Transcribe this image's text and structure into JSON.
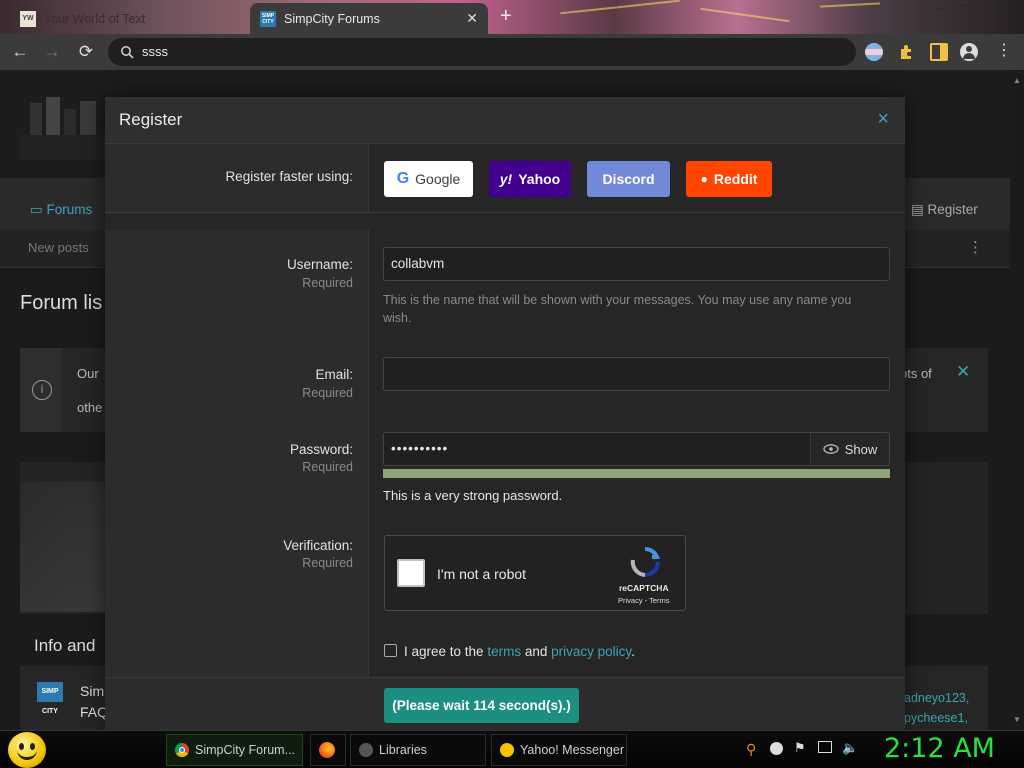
{
  "browser": {
    "tabs": [
      {
        "title": "Your World of Text",
        "favicon": "yw-favicon",
        "active": false
      },
      {
        "title": "SimpCity Forums",
        "favicon": "simpcity-favicon",
        "active": true
      }
    ],
    "favicon_text": {
      "yw": "YW",
      "simpcity": "SIMP CITY"
    },
    "new_tab_label": "+",
    "window_controls": [
      "–",
      "□",
      "✕"
    ],
    "address": "ssss",
    "toolbar_icons": [
      "profile-flag-icon",
      "extensions-icon",
      "sidepanel-icon",
      "account-icon",
      "menu-icon"
    ]
  },
  "background_page": {
    "nav_forums": "Forums",
    "nav_register": "Register",
    "new_posts": "New posts",
    "forum_list_title": "Forum lis",
    "notice_left_1": "Our",
    "notice_left_2": "othe",
    "notice_right": "ots of",
    "info_heading": "Info and",
    "info_line1": "Sim",
    "info_line2": "FAQ",
    "user1": "adneyo123,",
    "user2": "pycheese1,"
  },
  "modal": {
    "title": "Register",
    "close_label": "×",
    "register_faster_label": "Register faster using:",
    "sso_buttons": [
      {
        "label": "Google",
        "bg": "#ffffff",
        "fg": "#3c4043",
        "icon": "google-icon"
      },
      {
        "label": "Yahoo",
        "bg": "#43008f",
        "fg": "#ffffff",
        "icon": "yahoo-icon"
      },
      {
        "label": "Discord",
        "bg": "#7289da",
        "fg": "#ffffff",
        "icon": "discord-icon"
      },
      {
        "label": "Reddit",
        "bg": "#ff4500",
        "fg": "#ffffff",
        "icon": "reddit-icon"
      }
    ],
    "sso_icon_glyphs": {
      "google": "G",
      "yahoo": "y!",
      "reddit": "●"
    },
    "username": {
      "label": "Username:",
      "required": "Required",
      "value": "collabvm",
      "hint": "This is the name that will be shown with your messages. You may use any name you wish."
    },
    "email": {
      "label": "Email:",
      "required": "Required",
      "value": ""
    },
    "password": {
      "label": "Password:",
      "required": "Required",
      "value": "••••••••••",
      "show_label": "Show",
      "strength_text": "This is a very strong password.",
      "strength_fraction": 1.0,
      "strength_color": "#8fa37a"
    },
    "verification": {
      "label": "Verification:",
      "required": "Required",
      "captcha_text": "I'm not a robot",
      "captcha_brand": "reCAPTCHA",
      "captcha_links": "Privacy - Terms"
    },
    "agree": {
      "prefix": "I agree to the",
      "terms": "terms",
      "and": "and",
      "privacy": "privacy policy",
      "suffix": "."
    },
    "submit_label": "(Please wait 114 second(s).)",
    "accent": "#3da3b8",
    "submit_bg": "#1c8e82"
  },
  "taskbar": {
    "tasks": [
      {
        "label": "SimpCity Forum...",
        "icon": "chrome-icon"
      },
      {
        "label": "",
        "icon": "firefox-icon"
      },
      {
        "label": "Libraries",
        "icon": "libraries-icon"
      },
      {
        "label": "Yahoo! Messenger",
        "icon": "yahoo-messenger-icon"
      }
    ],
    "clock": "2:12 AM",
    "tray_icons": [
      "search-tray-icon",
      "messenger-tray-icon",
      "flag-tray-icon",
      "network-tray-icon",
      "volume-tray-icon"
    ]
  }
}
